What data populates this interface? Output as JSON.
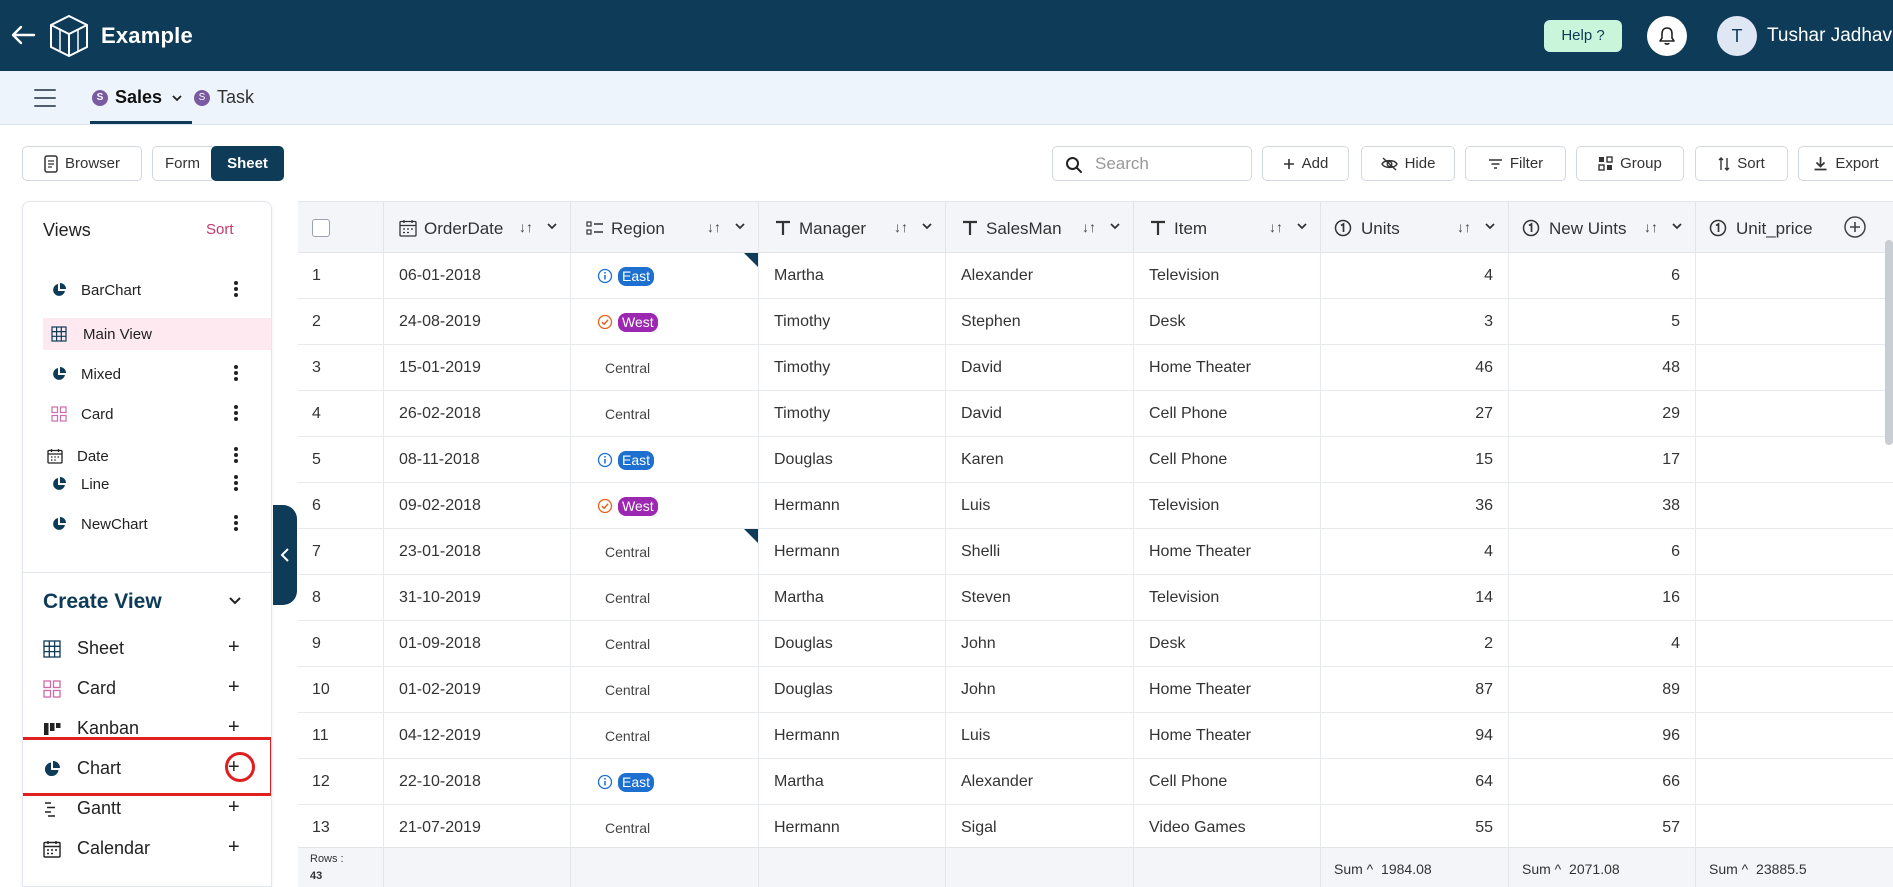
{
  "header": {
    "app_title": "Example",
    "help_label": "Help ?",
    "user_initial": "T",
    "user_name": "Tushar Jadhav"
  },
  "tabs": [
    {
      "label": "Sales",
      "badge": "S",
      "active": true
    },
    {
      "label": "Task",
      "badge": "S",
      "active": false
    }
  ],
  "toolbar": {
    "browser_label": "Browser",
    "form_label": "Form",
    "sheet_label": "Sheet",
    "search_placeholder": "Search",
    "add_label": "Add",
    "hide_label": "Hide",
    "filter_label": "Filter",
    "group_label": "Group",
    "sort_label": "Sort",
    "export_label": "Export"
  },
  "sidebar": {
    "views_title": "Views",
    "sort_label": "Sort",
    "views": [
      {
        "label": "BarChart",
        "icon": "pie-chart-icon"
      },
      {
        "label": "Main View",
        "icon": "grid-icon",
        "active": true
      },
      {
        "label": "Mixed",
        "icon": "pie-chart-icon"
      },
      {
        "label": "Card",
        "icon": "card-icon"
      },
      {
        "label": "Date",
        "icon": "calendar-icon"
      },
      {
        "label": "Line",
        "icon": "pie-chart-icon"
      },
      {
        "label": "NewChart",
        "icon": "pie-chart-icon"
      }
    ],
    "create_title": "Create View",
    "create_items": [
      {
        "label": "Sheet",
        "icon": "grid-icon"
      },
      {
        "label": "Card",
        "icon": "card-icon"
      },
      {
        "label": "Kanban",
        "icon": "kanban-icon"
      },
      {
        "label": "Chart",
        "icon": "pie-chart-icon"
      },
      {
        "label": "Gantt",
        "icon": "gantt-icon"
      },
      {
        "label": "Calendar",
        "icon": "calendar-icon"
      }
    ]
  },
  "grid": {
    "columns": [
      "OrderDate",
      "Region",
      "Manager",
      "SalesMan",
      "Item",
      "Units",
      "New Uints",
      "Unit_price"
    ],
    "rows": [
      {
        "n": "1",
        "date": "06-01-2018",
        "region": "East",
        "manager": "Martha",
        "salesman": "Alexander",
        "item": "Television",
        "units": "4",
        "new_units": "6"
      },
      {
        "n": "2",
        "date": "24-08-2019",
        "region": "West",
        "manager": "Timothy",
        "salesman": "Stephen",
        "item": "Desk",
        "units": "3",
        "new_units": "5"
      },
      {
        "n": "3",
        "date": "15-01-2019",
        "region": "Central",
        "manager": "Timothy",
        "salesman": "David",
        "item": "Home Theater",
        "units": "46",
        "new_units": "48"
      },
      {
        "n": "4",
        "date": "26-02-2018",
        "region": "Central",
        "manager": "Timothy",
        "salesman": "David",
        "item": "Cell Phone",
        "units": "27",
        "new_units": "29"
      },
      {
        "n": "5",
        "date": "08-11-2018",
        "region": "East",
        "manager": "Douglas",
        "salesman": "Karen",
        "item": "Cell Phone",
        "units": "15",
        "new_units": "17"
      },
      {
        "n": "6",
        "date": "09-02-2018",
        "region": "West",
        "manager": "Hermann",
        "salesman": "Luis",
        "item": "Television",
        "units": "36",
        "new_units": "38"
      },
      {
        "n": "7",
        "date": "23-01-2018",
        "region": "Central",
        "manager": "Hermann",
        "salesman": "Shelli",
        "item": "Home Theater",
        "units": "4",
        "new_units": "6"
      },
      {
        "n": "8",
        "date": "31-10-2019",
        "region": "Central",
        "manager": "Martha",
        "salesman": "Steven",
        "item": "Television",
        "units": "14",
        "new_units": "16"
      },
      {
        "n": "9",
        "date": "01-09-2018",
        "region": "Central",
        "manager": "Douglas",
        "salesman": "John",
        "item": "Desk",
        "units": "2",
        "new_units": "4"
      },
      {
        "n": "10",
        "date": "01-02-2019",
        "region": "Central",
        "manager": "Douglas",
        "salesman": "John",
        "item": "Home Theater",
        "units": "87",
        "new_units": "89"
      },
      {
        "n": "11",
        "date": "04-12-2019",
        "region": "Central",
        "manager": "Hermann",
        "salesman": "Luis",
        "item": "Home Theater",
        "units": "94",
        "new_units": "96"
      },
      {
        "n": "12",
        "date": "22-10-2018",
        "region": "East",
        "manager": "Martha",
        "salesman": "Alexander",
        "item": "Cell Phone",
        "units": "64",
        "new_units": "66"
      },
      {
        "n": "13",
        "date": "21-07-2019",
        "region": "Central",
        "manager": "Hermann",
        "salesman": "Sigal",
        "item": "Video Games",
        "units": "55",
        "new_units": "57"
      }
    ],
    "footer": {
      "rows_label": "Rows :",
      "rows_count": "43",
      "sum_label": "Sum",
      "units_sum": "1984.08",
      "new_units_sum": "2071.08",
      "unit_price_sum": "23885.5"
    }
  },
  "colors": {
    "brand": "#0d3b58",
    "east": "#1d6fd0",
    "west": "#9c27b0",
    "highlight": "#e02020"
  }
}
